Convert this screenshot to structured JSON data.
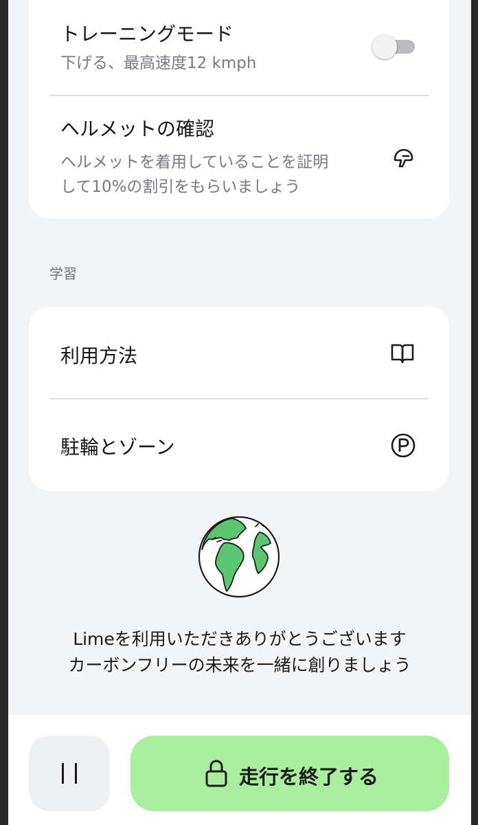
{
  "settings": {
    "training_mode": {
      "title": "トレーニングモード",
      "subtitle": "下げる、最高速度12 kmph",
      "enabled": false
    },
    "helmet": {
      "title": "ヘルメットの確認",
      "subtitle_line1": "ヘルメットを着用していることを証明",
      "subtitle_line2": "して10%の割引をもらいましょう",
      "icon": "helmet-icon"
    }
  },
  "learning": {
    "section_label": "学習",
    "items": [
      {
        "label": "利用方法",
        "icon": "book-icon"
      },
      {
        "label": "駐輪とゾーン",
        "icon": "parking-icon"
      }
    ]
  },
  "footer_message": {
    "line1": "Limeを利用いただきありがとうございます",
    "line2": "カーボンフリーの未来を一緒に創りましょう",
    "illustration": "globe-illustration"
  },
  "actions": {
    "pause_icon": "pause-icon",
    "end_ride_label": "走行を終了する",
    "end_ride_icon": "lock-icon",
    "end_ride_color": "#a8ef9e"
  }
}
